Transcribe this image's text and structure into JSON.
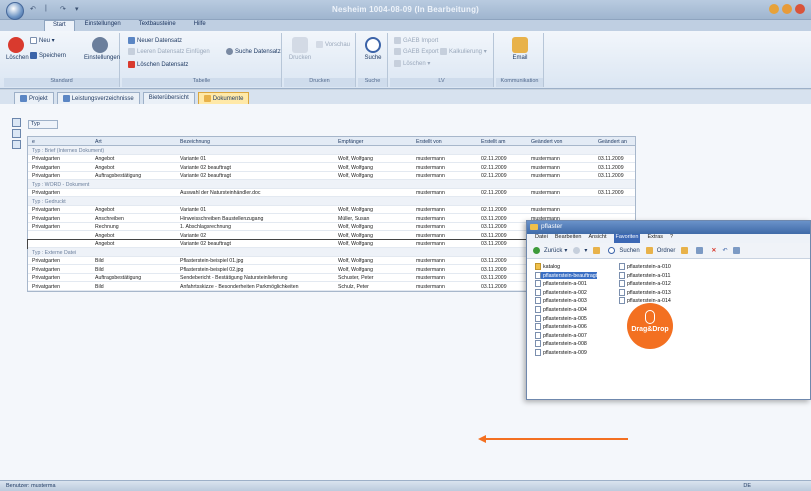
{
  "window": {
    "title": "Nesheim 1004-08-09 (In Bearbeitung)"
  },
  "ribbon_tabs": [
    "Start",
    "Einstellungen",
    "Textbausteine",
    "Hilfe"
  ],
  "ribbon": {
    "new_label": "Neu",
    "delete_label": "Löschen",
    "save_label": "Speichern",
    "settings_label": "Einstellungen",
    "new_record_label": "Neuer Datensatz",
    "insert_record_label": "Leeren Datensatz Einfügen",
    "delete_record_label": "Löschen Datensatz",
    "search_record_label": "Suche Datensatz",
    "print_label": "Drucken",
    "preview_label": "Vorschau",
    "search_label": "Suche",
    "gaeb_import_label": "GAEB Import",
    "gaeb_export_label": "GAEB Export",
    "katalog_label": "Kalkulierung",
    "loeschen_label": "Löschen",
    "email_label": "Email",
    "groups": [
      "Standard",
      "Tabelle",
      "Drucken",
      "Suche",
      "LV",
      "Kommunikation"
    ]
  },
  "doc_tabs": [
    "Projekt",
    "Leistungsverzeichnisse",
    "Bieterübersicht",
    "Dokumente"
  ],
  "group_by_label": "Typ",
  "grid": {
    "columns": [
      "Art",
      "Bezeichnung",
      "Empfänger",
      "Erstellt von",
      "Erstellt am",
      "Geändert von",
      "Geändert an"
    ],
    "first_col_header": "e",
    "groups": [
      {
        "title": "Typ : Brief (Internes Dokument)",
        "rows": [
          {
            "a": "Privatgarten",
            "b": "Angebot",
            "c": "Variante 01",
            "d": "Wolf, Wolfgang",
            "e": "mustermann",
            "f": "02.11.2009",
            "g": "mustermann",
            "h": "03.11.2009"
          },
          {
            "a": "Privatgarten",
            "b": "Angebot",
            "c": "Variante 02 beauftragt",
            "d": "Wolf, Wolfgang",
            "e": "mustermann",
            "f": "02.11.2009",
            "g": "mustermann",
            "h": "03.11.2009"
          },
          {
            "a": "Privatgarten",
            "b": "Auftragsbestätigung",
            "c": "Variante 02 beauftragt",
            "d": "Wolf, Wolfgang",
            "e": "mustermann",
            "f": "02.11.2009",
            "g": "mustermann",
            "h": "03.11.2009"
          }
        ]
      },
      {
        "title": "Typ : WORD - Dokument",
        "rows": [
          {
            "a": "Privatgarten",
            "b": "",
            "c": "Auswahl der Natursteinhändler.doc",
            "d": "",
            "e": "mustermann",
            "f": "02.11.2009",
            "g": "mustermann",
            "h": "03.11.2009"
          }
        ]
      },
      {
        "title": "Typ : Gedruckt",
        "rows": [
          {
            "a": "Privatgarten",
            "b": "Angebot",
            "c": "Variante 01",
            "d": "Wolf, Wolfgang",
            "e": "mustermann",
            "f": "02.11.2009",
            "g": "mustermann",
            "h": ""
          },
          {
            "a": "Privatgarten",
            "b": "Anschreiben",
            "c": "Hinweisschreiben Baustellenzugang",
            "d": "Müller, Susan",
            "e": "mustermann",
            "f": "03.11.2009",
            "g": "mustermann",
            "h": ""
          },
          {
            "a": "Privatgarten",
            "b": "Rechnung",
            "c": "1. Abschlagsrechnung",
            "d": "Wolf, Wolfgang",
            "e": "mustermann",
            "f": "03.11.2009",
            "g": "mustermann",
            "h": ""
          },
          {
            "a": "",
            "b": "Angebot",
            "c": "Variante 02",
            "d": "Wolf, Wolfgang",
            "e": "mustermann",
            "f": "03.11.2009",
            "g": "mustermann",
            "h": ""
          },
          {
            "a": "",
            "b": "Angebot",
            "c": "Variante 02 beauftragt",
            "d": "Wolf, Wolfgang",
            "e": "mustermann",
            "f": "03.11.2009",
            "g": "mustermann",
            "h": ""
          }
        ]
      },
      {
        "title": "Typ : Externe Datei",
        "rows": [
          {
            "a": "Privatgarten",
            "b": "Bild",
            "c": "Pflasterstein-beispiel 01.jpg",
            "d": "Wolf, Wolfgang",
            "e": "mustermann",
            "f": "03.11.2009",
            "g": "mustermann",
            "h": ""
          },
          {
            "a": "Privatgarten",
            "b": "Bild",
            "c": "Pflasterstein-beispiel 02.jpg",
            "d": "Wolf, Wolfgang",
            "e": "mustermann",
            "f": "03.11.2009",
            "g": "mustermann",
            "h": ""
          },
          {
            "a": "Privatgarten",
            "b": "Auftragsbestätigung",
            "c": "Sendebericht - Bestätigung Natursteinlieferung",
            "d": "Schuster, Peter",
            "e": "mustermann",
            "f": "03.11.2009",
            "g": "mustermann",
            "h": ""
          },
          {
            "a": "Privatgarten",
            "b": "Bild",
            "c": "Anfahrtsskizze - Besonderheiten Parkmöglichkeiten",
            "d": "Schulz, Peter",
            "e": "mustermann",
            "f": "03.11.2009",
            "g": "mustermann",
            "h": ""
          }
        ]
      }
    ]
  },
  "explorer": {
    "title": "pflaster",
    "menu": [
      "Datei",
      "Bearbeiten",
      "Ansicht",
      "Favoriten",
      "Extras",
      "?"
    ],
    "toolbar": {
      "back": "Zurück",
      "search": "Suchen",
      "folders": "Ordner"
    },
    "files_left": [
      "katalog",
      "pflasterstein-beauftragt",
      "pflasterstein-a-001",
      "pflasterstein-a-002",
      "pflasterstein-a-003",
      "pflasterstein-a-004",
      "pflasterstein-a-005",
      "pflasterstein-a-006",
      "pflasterstein-a-007",
      "pflasterstein-a-008",
      "pflasterstein-a-009"
    ],
    "files_right": [
      "pflasterstein-a-010",
      "pflasterstein-a-011",
      "pflasterstein-a-012",
      "pflasterstein-a-013",
      "pflasterstein-a-014"
    ]
  },
  "badge": {
    "text": "Drag&Drop"
  },
  "status": {
    "user": "Benutzer: musterma",
    "right": "DE"
  },
  "colors": {
    "accent": "#f37021",
    "selection": "#3a6fc4",
    "active_tab": "#ffe9a8"
  }
}
